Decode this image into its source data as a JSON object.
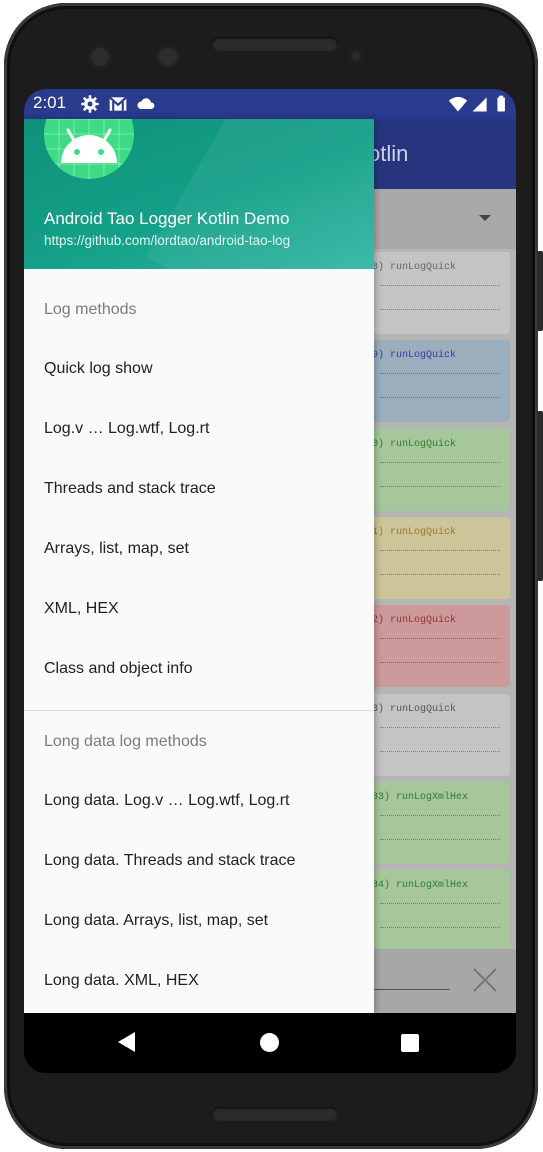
{
  "status_bar": {
    "time": "2:01",
    "left_icons": [
      "settings-icon",
      "gmail-icon",
      "cloud-icon"
    ],
    "right_icons": [
      "wifi-icon",
      "signal-icon",
      "battery-icon"
    ]
  },
  "app": {
    "toolbar_title_visible": "otlin",
    "log_cards": [
      {
        "text": "8) runLogQuick",
        "color": "#c4c4c4",
        "text_color": "#666666"
      },
      {
        "text": "9) runLogQuick",
        "color": "#9aaebd",
        "text_color": "#3a3aa0"
      },
      {
        "text": "0) runLogQuick",
        "color": "#a6c79a",
        "text_color": "#2e7d2e"
      },
      {
        "text": "1) runLogQuick",
        "color": "#cdc49a",
        "text_color": "#9a7a2a"
      },
      {
        "text": "2) runLogQuick",
        "color": "#cc9a9a",
        "text_color": "#9a2e2e"
      },
      {
        "text": "3) runLogQuick",
        "color": "#c4c4c4",
        "text_color": "#555555"
      },
      {
        "text": "83) runLogXmlHex",
        "color": "#a6c79a",
        "text_color": "#2e7d2e"
      },
      {
        "text": "84) runLogXmlHex",
        "color": "#a6c79a",
        "text_color": "#2e7d2e"
      }
    ]
  },
  "drawer": {
    "header": {
      "title": "Android Tao Logger Kotlin Demo",
      "subtitle": "https://github.com/lordtao/android-tao-log"
    },
    "section1": "Log methods",
    "items1": [
      {
        "label": "Quick log show"
      },
      {
        "label": "Log.v … Log.wtf, Log.rt"
      },
      {
        "label": "Threads and stack trace"
      },
      {
        "label": "Arrays, list, map, set"
      },
      {
        "label": "XML, HEX"
      },
      {
        "label": "Class and object info"
      }
    ],
    "section2": "Long data log methods",
    "items2": [
      {
        "label": "Long data. Log.v … Log.wtf, Log.rt"
      },
      {
        "label": "Long data. Threads and stack trace"
      },
      {
        "label": "Long data. Arrays, list, map, set"
      },
      {
        "label": "Long data. XML, HEX"
      }
    ]
  },
  "nav_bar": {
    "buttons": [
      "back-icon",
      "home-icon",
      "recents-icon"
    ]
  }
}
